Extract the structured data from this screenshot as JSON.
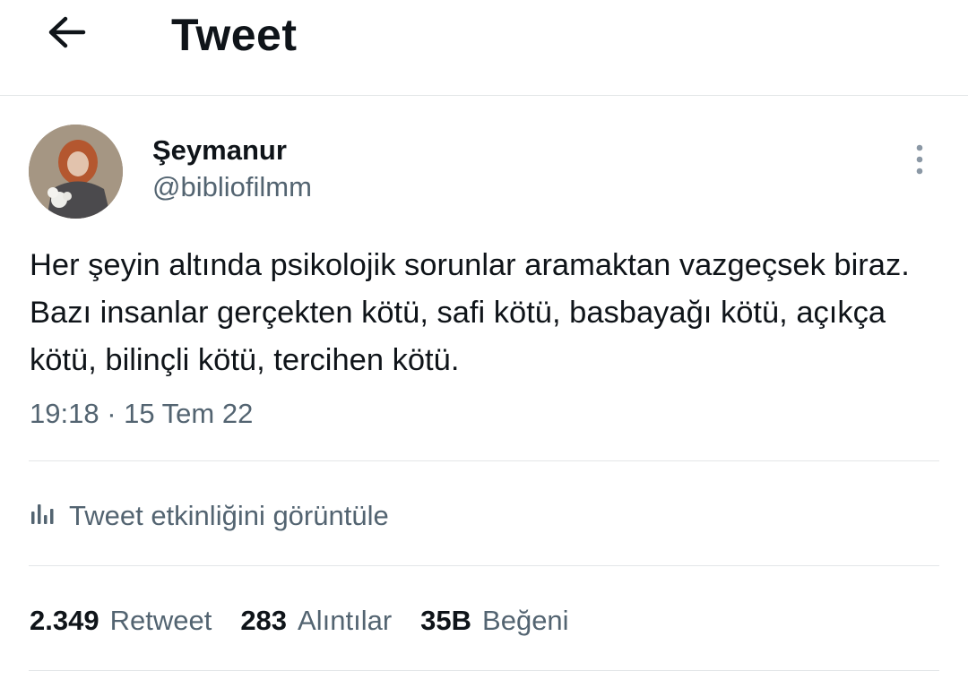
{
  "header": {
    "title": "Tweet",
    "back_icon": "arrow-left-icon"
  },
  "tweet": {
    "display_name": "Şeymanur",
    "handle": "@bibliofilmm",
    "text": "Her şeyin altında psikolojik sorunlar aramaktan vazgeçsek biraz. Bazı insanlar gerçekten kötü, safi kötü, basbayağı kötü, açıkça kötü, bilinçli kötü, tercihen kötü.",
    "timestamp": "19:18 · 15 Tem 22",
    "more_icon": "more-vertical-icon"
  },
  "activity": {
    "label": "Tweet etkinliğini görüntüle",
    "icon": "analytics-icon"
  },
  "stats": {
    "retweets": {
      "count": "2.349",
      "label": "Retweet"
    },
    "quotes": {
      "count": "283",
      "label": "Alıntılar"
    },
    "likes": {
      "count": "35B",
      "label": "Beğeni"
    }
  },
  "colors": {
    "primary_text": "#0f1419",
    "secondary_text": "#536471",
    "divider": "#e3e6e8",
    "background": "#ffffff"
  }
}
